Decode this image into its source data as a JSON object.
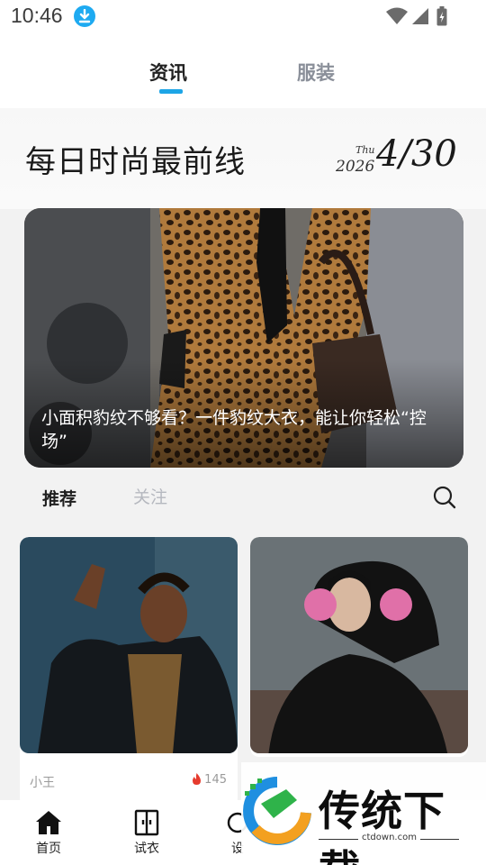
{
  "status_bar": {
    "time": "10:46",
    "icons": [
      "download-icon",
      "wifi-icon",
      "cellular-signal-icon",
      "battery-charging-icon"
    ]
  },
  "top_tabs": [
    {
      "label": "资讯",
      "active": true
    },
    {
      "label": "服装",
      "active": false
    }
  ],
  "date_header": {
    "title": "每日时尚最前线",
    "weekday": "Thu",
    "year": "2026",
    "date": "4/30"
  },
  "hero": {
    "caption": "小面积豹纹不够看？一件豹纹大衣，能让你轻松“控场”"
  },
  "feed_tabs": [
    {
      "label": "推荐",
      "active": true
    },
    {
      "label": "关注",
      "active": false
    }
  ],
  "cards": [
    {
      "author": "小王",
      "likes": "145"
    },
    {
      "author": "",
      "likes": ""
    }
  ],
  "bottom_nav": [
    {
      "label": "首页",
      "icon": "home-icon"
    },
    {
      "label": "试衣",
      "icon": "wardrobe-icon"
    },
    {
      "label": "设",
      "icon": "settings-icon"
    }
  ],
  "watermark": {
    "title": "传统下载",
    "url": "ctdown.com"
  },
  "colors": {
    "accent": "#1da5e6",
    "badge": "#1eaaf1",
    "flame": "#e63b2e",
    "inactive_tab": "#8a8f99"
  }
}
